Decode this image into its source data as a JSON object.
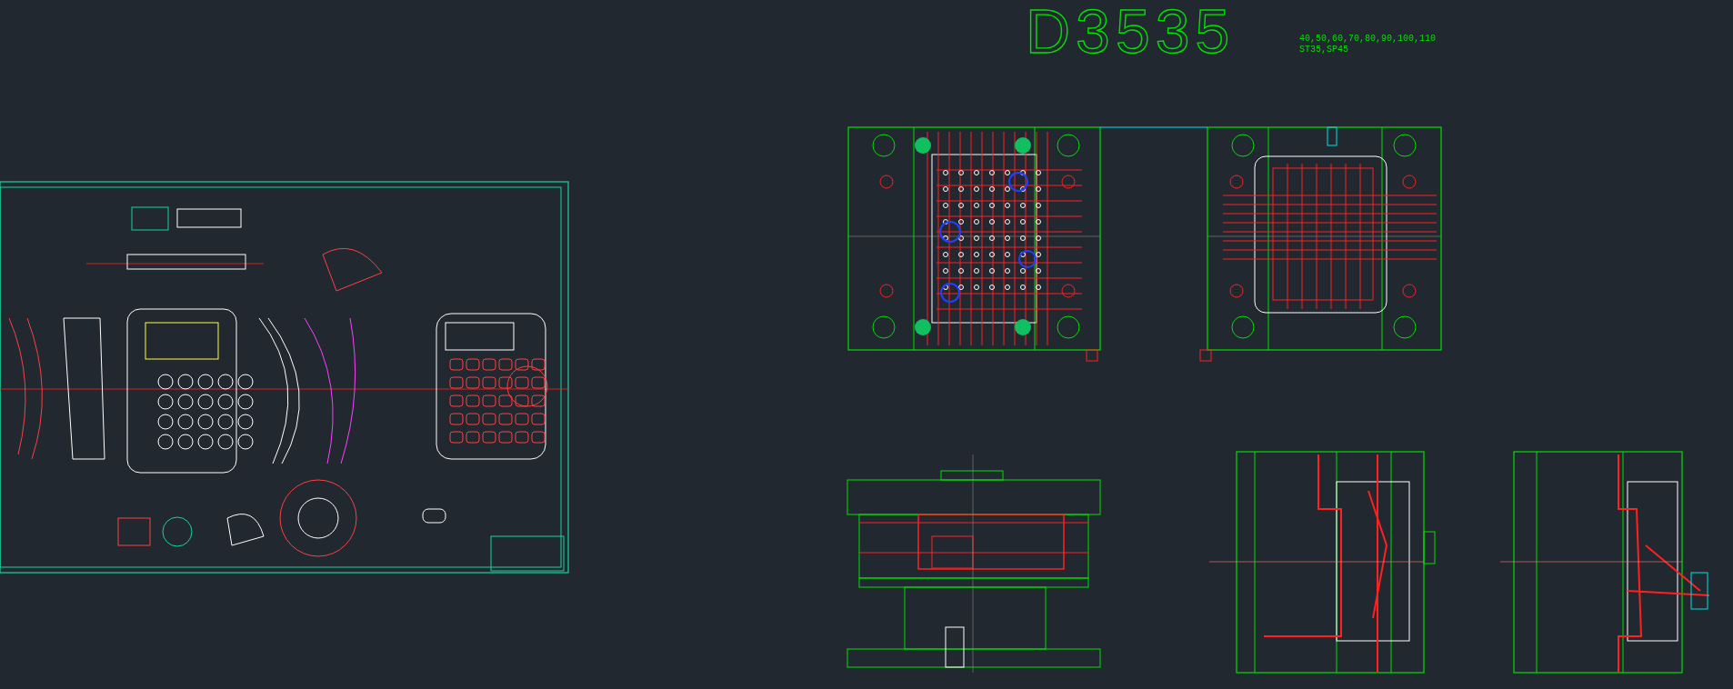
{
  "drawing_title": "D3535",
  "notes": [
    "40,50,60,70,80,90,100,110",
    "ST35,SP45"
  ]
}
